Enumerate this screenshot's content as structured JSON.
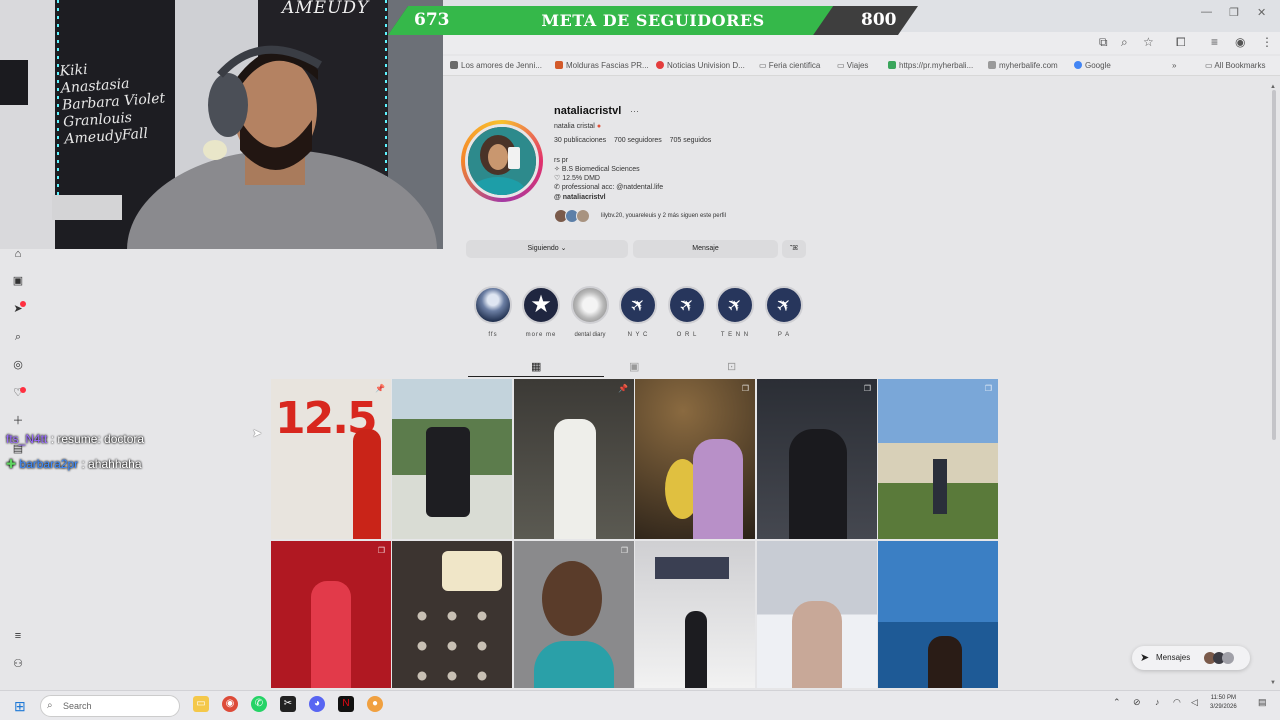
{
  "goal": {
    "current": "673",
    "title": "META DE SEGUIDORES",
    "target": "800",
    "progress": 0.84
  },
  "webcam": {
    "board_lines": [
      "Kiki",
      "Anastasia",
      "Barbara Violet",
      "Granlouis",
      "AmeudyFall"
    ],
    "sign": "AMEUDY"
  },
  "bookmarks": [
    {
      "label": "Los amores de Jenni...",
      "color": "#6b6b6b"
    },
    {
      "label": "Molduras Fascias PR...",
      "color": "#d35a2a"
    },
    {
      "label": "Noticias Univision D...",
      "color": "#e43d3d"
    },
    {
      "label": "Feria cientifica",
      "color": "#555555"
    },
    {
      "label": "Viajes",
      "color": "#555555"
    },
    {
      "label": "https://pr.myherbali...",
      "color": "#3aa55b"
    },
    {
      "label": "myherbalife.com",
      "color": "#9a9a9a"
    },
    {
      "label": "Google",
      "color": "#4285f4"
    },
    {
      "label": "All Bookmarks",
      "color": "#555555"
    }
  ],
  "profile": {
    "username": "nataliacristvl",
    "display_name": "natalia cristal",
    "posts": "30 publicaciones",
    "followers": "700 seguidores",
    "following": "705 seguidos",
    "bio": [
      "rs pr",
      "B.S Biomedical Sciences",
      "12.5% DMD",
      "professional acc: @natdental.life"
    ],
    "threads": "nataliacristvl",
    "followed_by": "lilybv.20, youareleuis y 2 más siguen este perfil",
    "btn_following": "Siguiendo",
    "btn_message": "Mensaje"
  },
  "highlights": [
    "ffs",
    "more me",
    "dental diary",
    "N Y C",
    "O R L",
    "T E N N",
    "P A"
  ],
  "chat": [
    {
      "user": "fts_N4tt",
      "message": ": resume: doctora"
    },
    {
      "user": "barbara2pr",
      "message": ": ahahhaha"
    }
  ],
  "posts_row1_text": "12.5",
  "messages_pill": "Mensajes",
  "taskbar": {
    "search_placeholder": "Search",
    "time": "11:50 PM",
    "date": "3/29/2026"
  }
}
